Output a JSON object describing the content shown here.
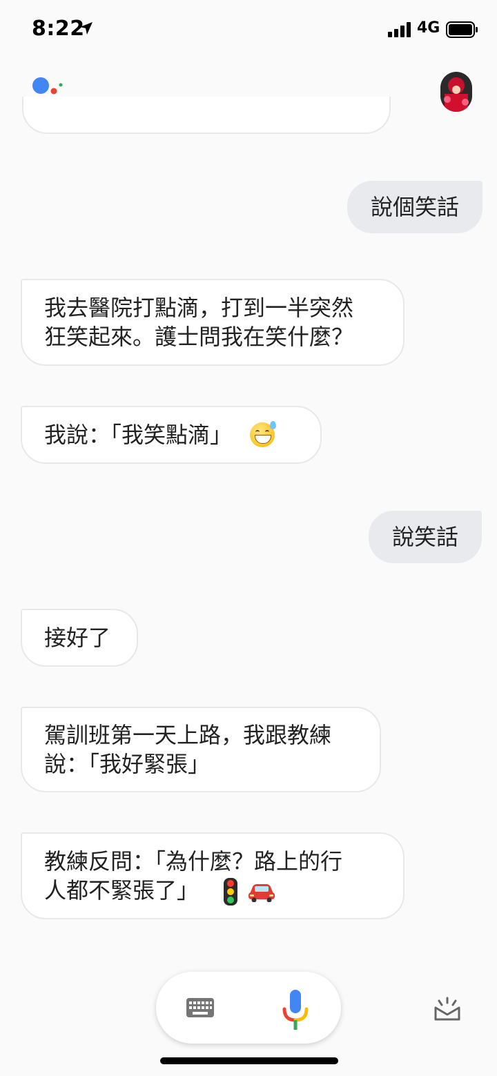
{
  "status_bar": {
    "time": "8:22",
    "network": "4G"
  },
  "conversation": {
    "user_1": "說個笑話",
    "assistant_1": "我去醫院打點滴，打到一半突然\n狂笑起來。護士問我在笑什麼？",
    "assistant_2": "我說：「我笑點滴」",
    "user_2": "說笑話",
    "assistant_3": "接好了",
    "assistant_4": "駕訓班第一天上路，我跟教練\n說：「我好緊張」",
    "assistant_5": "教練反問：「為什麼？路上的行\n人都不緊張了」"
  },
  "icons": {
    "assistant_logo": "google-assistant-icon",
    "keyboard": "keyboard-icon",
    "mic": "mic-icon",
    "explore": "explore-icon",
    "emoji_1": "grinning-sweat-emoji-icon",
    "emoji_2": "traffic-light-icon",
    "emoji_3": "car-icon"
  },
  "colors": {
    "background": "#fafafa",
    "user_bubble": "#e8eaed",
    "assistant_bubble": "#ffffff",
    "google_blue": "#4285f4",
    "google_red": "#ea4335",
    "google_yellow": "#fbbc05",
    "google_green": "#34a853"
  }
}
